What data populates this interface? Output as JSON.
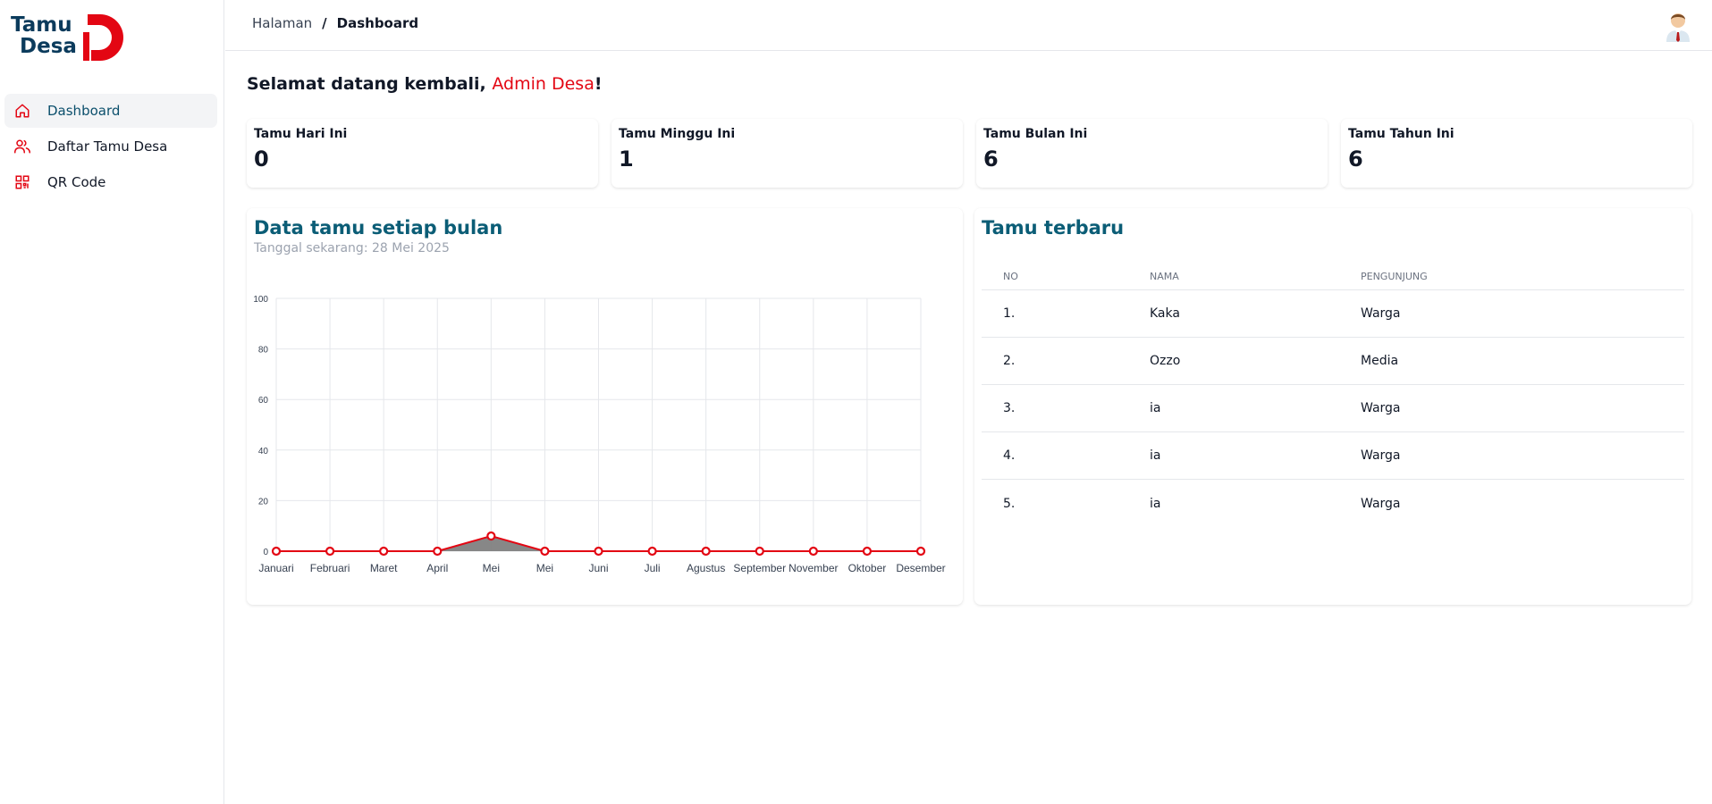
{
  "brand": {
    "line1": "Tamu",
    "line2": "Desa",
    "color": "#0b3b5c",
    "accent": "#e30613"
  },
  "sidebar": {
    "items": [
      {
        "label": "Dashboard",
        "icon": "home-icon",
        "active": true
      },
      {
        "label": "Daftar Tamu Desa",
        "icon": "users-icon",
        "active": false
      },
      {
        "label": "QR Code",
        "icon": "qr-code-icon",
        "active": false
      }
    ]
  },
  "header": {
    "breadcrumb": {
      "root": "Halaman",
      "separator": "/",
      "current": "Dashboard"
    },
    "avatar_icon": "user-avatar-icon"
  },
  "welcome": {
    "prefix": "Selamat datang kembali, ",
    "name": "Admin Desa",
    "suffix": "!"
  },
  "stats": [
    {
      "label": "Tamu Hari Ini",
      "value": "0"
    },
    {
      "label": "Tamu Minggu Ini",
      "value": "1"
    },
    {
      "label": "Tamu Bulan Ini",
      "value": "6"
    },
    {
      "label": "Tamu Tahun Ini",
      "value": "6"
    }
  ],
  "chart_card": {
    "title": "Data tamu setiap bulan",
    "subtitle": "Tanggal sekarang: 28 Mei 2025"
  },
  "chart_data": {
    "type": "area",
    "categories": [
      "Januari",
      "Februari",
      "Maret",
      "April",
      "Mei",
      "Mei",
      "Juni",
      "Juli",
      "Agustus",
      "September",
      "November",
      "Oktober",
      "Desember"
    ],
    "series": [
      {
        "values": [
          0,
          0,
          0,
          0,
          6,
          0,
          0,
          0,
          0,
          0,
          0,
          0,
          0
        ]
      }
    ],
    "ylim": [
      0,
      100
    ],
    "yticks": [
      0,
      20,
      40,
      60,
      80,
      100
    ],
    "grid": true,
    "line_color": "#e30613",
    "fill_color": "#7a7a7a"
  },
  "table_card": {
    "title": "Tamu terbaru",
    "columns": [
      "NO",
      "NAMA",
      "PENGUNJUNG"
    ],
    "rows": [
      [
        "1.",
        "Kaka",
        "Warga"
      ],
      [
        "2.",
        "Ozzo",
        "Media"
      ],
      [
        "3.",
        "ia",
        "Warga"
      ],
      [
        "4.",
        "ia",
        "Warga"
      ],
      [
        "5.",
        "ia",
        "Warga"
      ]
    ]
  }
}
